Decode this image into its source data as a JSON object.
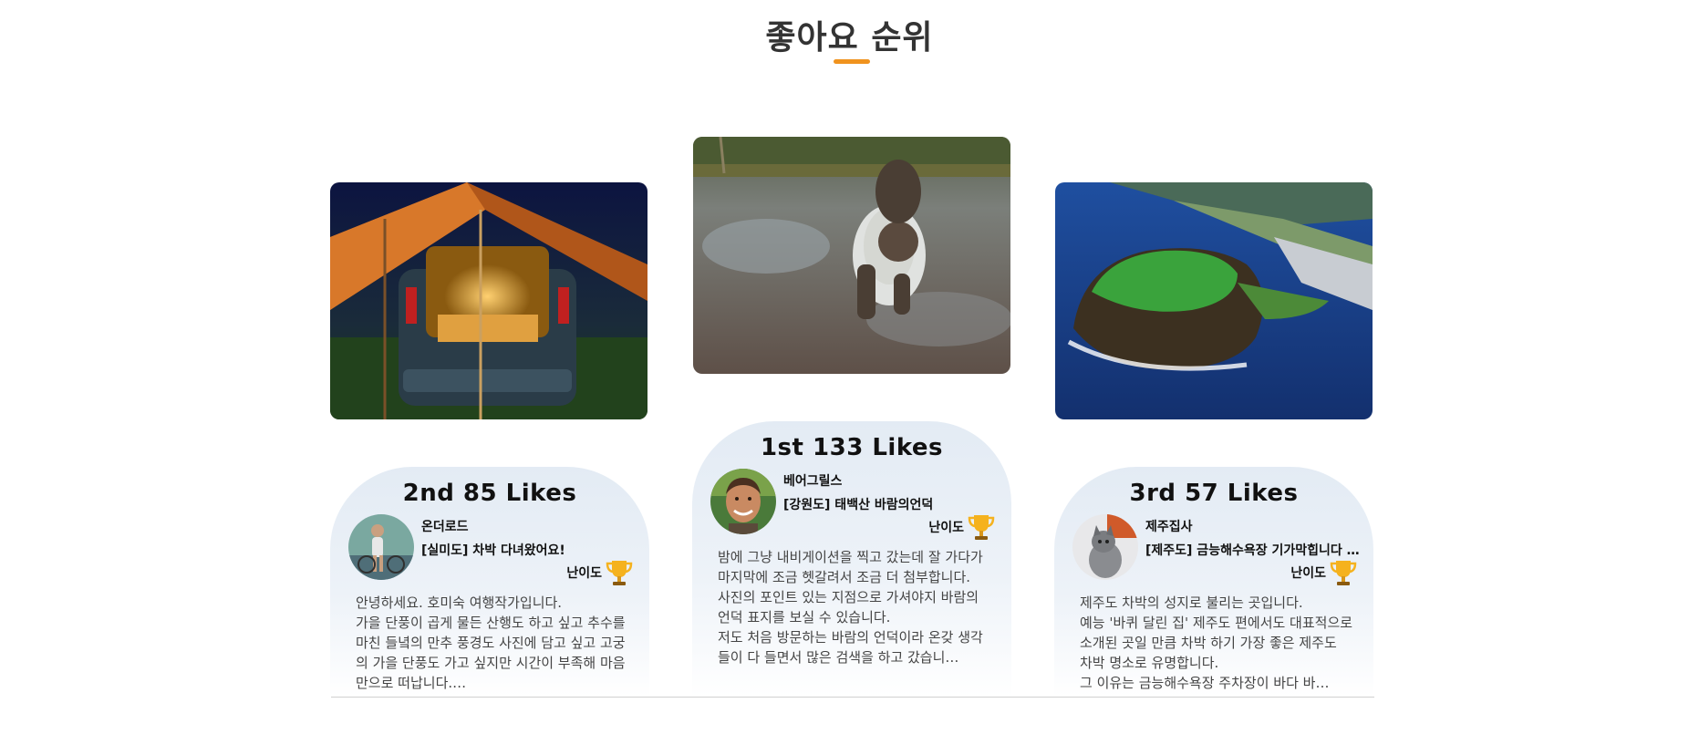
{
  "section": {
    "title": "좋아요 순위",
    "accent_color": "#f0931e"
  },
  "cards": [
    {
      "rank_text": "2nd 85 Likes",
      "author": "온더로드",
      "post_title": "[실미도] 차박 다녀왔어요!",
      "difficulty_label": "난이도",
      "difficulty_icon": "trophy-icon",
      "body": "안녕하세요. 호미숙 여행작가입니다.\n가을 단풍이 곱게 물든 산행도 하고 싶고 추수를 마친 들녘의 만추 풍경도 사진에 담고 싶고 고궁의 가을 단풍도 가고 싶지만 시간이 부족해 마음만으로 떠납니다.…",
      "photo": "car-camping-tent-photo",
      "avatar": "person-with-bicycle-avatar"
    },
    {
      "rank_text": "1st 133 Likes",
      "author": "베어그릴스",
      "post_title": "[강원도] 태백산 바람의언덕",
      "difficulty_label": "난이도",
      "difficulty_icon": "trophy-icon",
      "body": "밤에 그냥 내비게이션을 찍고 갔는데 잘 가다가 마지막에 조금 헷갈려서 조금 더 첨부합니다.\n사진의 포인트 있는 지점으로 가셔야지 바람의 언덕 표지를 보실 수 있습니다.\n저도 처음 방문하는 바람의 언덕이라 온갖 생각들이 다 들면서 많은 검색을 하고 갔습니…",
      "photo": "man-crawling-in-mud-photo",
      "avatar": "smiling-man-avatar"
    },
    {
      "rank_text": "3rd 57 Likes",
      "author": "제주집사",
      "post_title": "[제주도] 금능해수욕장 기가막힙니다 진짜!",
      "difficulty_label": "난이도",
      "difficulty_icon": "trophy-icon",
      "body": "제주도 차박의 성지로 불리는 곳입니다.\n예능 '바퀴 달린 집' 제주도 편에서도 대표적으로 소개된 곳일 만큼 차박 하기 가장 좋은 제주도 차박 명소로 유명합니다.\n그 이유는 금능해수욕장 주차장이 바다 바…",
      "photo": "jeju-volcanic-crater-photo",
      "avatar": "gray-cat-avatar"
    }
  ]
}
